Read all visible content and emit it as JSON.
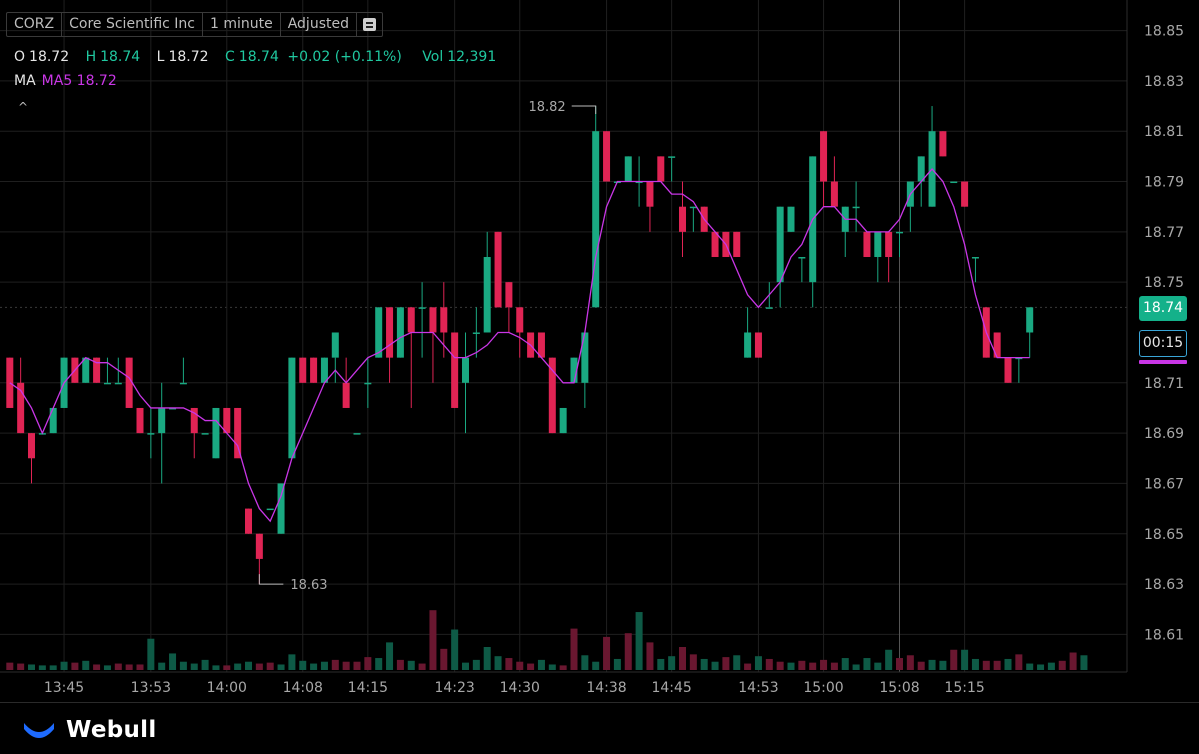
{
  "header": {
    "symbol": "CORZ",
    "name": "Core Scientific Inc",
    "interval": "1 minute",
    "adjust": "Adjusted"
  },
  "ohlc": {
    "o_label": "O",
    "o": "18.72",
    "h_label": "H",
    "h": "18.74",
    "l_label": "L",
    "l": "18.72",
    "c_label": "C",
    "c": "18.74",
    "change": "+0.02 (+0.11%)",
    "vol_label": "Vol",
    "vol": "12,391"
  },
  "ma": {
    "label": "MA",
    "text": "MA5 18.72"
  },
  "current_price": "18.74",
  "countdown": "00:15",
  "brand": "Webull",
  "colors": {
    "up": "#1aa982",
    "down": "#e02454",
    "ma": "#c936e6",
    "accent": "#14b18a"
  },
  "chart_data": {
    "type": "candlestick",
    "y_ticks": [
      "18.85",
      "18.83",
      "18.81",
      "18.79",
      "18.77",
      "18.75",
      "18.74",
      "18.71",
      "18.69",
      "18.67",
      "18.65",
      "18.63",
      "18.61"
    ],
    "x_ticks": [
      {
        "label": "13:45",
        "i": 5
      },
      {
        "label": "13:53",
        "i": 13
      },
      {
        "label": "14:00",
        "i": 20
      },
      {
        "label": "14:08",
        "i": 27
      },
      {
        "label": "14:15",
        "i": 33
      },
      {
        "label": "14:23",
        "i": 41
      },
      {
        "label": "14:30",
        "i": 47
      },
      {
        "label": "14:38",
        "i": 55
      },
      {
        "label": "14:45",
        "i": 61
      },
      {
        "label": "14:53",
        "i": 69
      },
      {
        "label": "15:00",
        "i": 75
      },
      {
        "label": "15:08",
        "i": 82
      },
      {
        "label": "15:15",
        "i": 88
      }
    ],
    "ylim": [
      18.603,
      18.855
    ],
    "high_annotation": "18.82",
    "low_annotation": "18.63",
    "grid": true,
    "candles": [
      [
        18.72,
        18.72,
        18.7,
        18.7
      ],
      [
        18.71,
        18.72,
        18.69,
        18.69
      ],
      [
        18.69,
        18.69,
        18.67,
        18.68
      ],
      [
        18.69,
        18.69,
        18.69,
        18.69
      ],
      [
        18.69,
        18.7,
        18.69,
        18.7
      ],
      [
        18.7,
        18.72,
        18.7,
        18.72
      ],
      [
        18.72,
        18.72,
        18.71,
        18.71
      ],
      [
        18.71,
        18.72,
        18.71,
        18.72
      ],
      [
        18.72,
        18.72,
        18.71,
        18.71
      ],
      [
        18.71,
        18.72,
        18.71,
        18.71
      ],
      [
        18.71,
        18.72,
        18.71,
        18.71
      ],
      [
        18.72,
        18.72,
        18.7,
        18.7
      ],
      [
        18.7,
        18.7,
        18.69,
        18.69
      ],
      [
        18.69,
        18.7,
        18.68,
        18.69
      ],
      [
        18.69,
        18.71,
        18.67,
        18.7
      ],
      [
        18.7,
        18.7,
        18.7,
        18.7
      ],
      [
        18.71,
        18.72,
        18.71,
        18.71
      ],
      [
        18.7,
        18.7,
        18.68,
        18.69
      ],
      [
        18.69,
        18.69,
        18.69,
        18.69
      ],
      [
        18.68,
        18.7,
        18.68,
        18.7
      ],
      [
        18.7,
        18.7,
        18.69,
        18.69
      ],
      [
        18.7,
        18.7,
        18.69,
        18.68
      ],
      [
        18.66,
        18.66,
        18.65,
        18.65
      ],
      [
        18.65,
        18.65,
        18.63,
        18.64
      ],
      [
        18.66,
        18.66,
        18.66,
        18.66
      ],
      [
        18.65,
        18.67,
        18.65,
        18.67
      ],
      [
        18.68,
        18.72,
        18.68,
        18.72
      ],
      [
        18.72,
        18.72,
        18.71,
        18.71
      ],
      [
        18.72,
        18.72,
        18.71,
        18.71
      ],
      [
        18.71,
        18.72,
        18.71,
        18.72
      ],
      [
        18.72,
        18.72,
        18.71,
        18.73
      ],
      [
        18.71,
        18.72,
        18.7,
        18.7
      ],
      [
        18.69,
        18.69,
        18.69,
        18.69
      ],
      [
        18.71,
        18.72,
        18.7,
        18.71
      ],
      [
        18.72,
        18.74,
        18.72,
        18.74
      ],
      [
        18.74,
        18.74,
        18.71,
        18.72
      ],
      [
        18.72,
        18.74,
        18.72,
        18.74
      ],
      [
        18.74,
        18.74,
        18.7,
        18.73
      ],
      [
        18.74,
        18.75,
        18.72,
        18.74
      ],
      [
        18.74,
        18.74,
        18.71,
        18.73
      ],
      [
        18.74,
        18.75,
        18.72,
        18.73
      ],
      [
        18.73,
        18.73,
        18.7,
        18.7
      ],
      [
        18.71,
        18.73,
        18.69,
        18.72
      ],
      [
        18.73,
        18.74,
        18.72,
        18.73
      ],
      [
        18.73,
        18.77,
        18.73,
        18.76
      ],
      [
        18.77,
        18.77,
        18.74,
        18.74
      ],
      [
        18.75,
        18.75,
        18.73,
        18.74
      ],
      [
        18.74,
        18.74,
        18.72,
        18.73
      ],
      [
        18.73,
        18.73,
        18.72,
        18.72
      ],
      [
        18.73,
        18.73,
        18.72,
        18.72
      ],
      [
        18.72,
        18.72,
        18.69,
        18.69
      ],
      [
        18.69,
        18.7,
        18.69,
        18.7
      ],
      [
        18.71,
        18.72,
        18.71,
        18.72
      ],
      [
        18.71,
        18.72,
        18.7,
        18.73
      ],
      [
        18.74,
        18.82,
        18.74,
        18.81
      ],
      [
        18.81,
        18.81,
        18.79,
        18.79
      ],
      [
        18.79,
        18.79,
        18.79,
        18.79
      ],
      [
        18.79,
        18.8,
        18.79,
        18.8
      ],
      [
        18.79,
        18.8,
        18.78,
        18.79
      ],
      [
        18.79,
        18.79,
        18.77,
        18.78
      ],
      [
        18.8,
        18.8,
        18.79,
        18.79
      ],
      [
        18.8,
        18.8,
        18.79,
        18.8
      ],
      [
        18.78,
        18.79,
        18.76,
        18.77
      ],
      [
        18.78,
        18.78,
        18.77,
        18.78
      ],
      [
        18.78,
        18.78,
        18.77,
        18.77
      ],
      [
        18.77,
        18.77,
        18.76,
        18.76
      ],
      [
        18.77,
        18.77,
        18.76,
        18.76
      ],
      [
        18.77,
        18.77,
        18.76,
        18.76
      ],
      [
        18.72,
        18.74,
        18.72,
        18.73
      ],
      [
        18.73,
        18.73,
        18.72,
        18.72
      ],
      [
        18.74,
        18.75,
        18.74,
        18.74
      ],
      [
        18.75,
        18.78,
        18.74,
        18.78
      ],
      [
        18.77,
        18.78,
        18.77,
        18.78
      ],
      [
        18.76,
        18.76,
        18.75,
        18.76
      ],
      [
        18.75,
        18.8,
        18.74,
        18.8
      ],
      [
        18.81,
        18.81,
        18.78,
        18.79
      ],
      [
        18.79,
        18.8,
        18.78,
        18.78
      ],
      [
        18.77,
        18.78,
        18.76,
        18.78
      ],
      [
        18.78,
        18.79,
        18.77,
        18.78
      ],
      [
        18.77,
        18.77,
        18.76,
        18.76
      ],
      [
        18.76,
        18.77,
        18.75,
        18.77
      ],
      [
        18.77,
        18.77,
        18.75,
        18.76
      ],
      [
        18.77,
        18.77,
        18.76,
        18.77
      ],
      [
        18.78,
        18.78,
        18.77,
        18.79
      ],
      [
        18.79,
        18.8,
        18.78,
        18.8
      ],
      [
        18.78,
        18.82,
        18.78,
        18.81
      ],
      [
        18.81,
        18.81,
        18.8,
        18.8
      ],
      [
        18.79,
        18.79,
        18.79,
        18.79
      ],
      [
        18.79,
        18.79,
        18.78,
        18.78
      ],
      [
        18.76,
        18.76,
        18.75,
        18.76
      ],
      [
        18.74,
        18.74,
        18.72,
        18.72
      ],
      [
        18.73,
        18.73,
        18.72,
        18.72
      ],
      [
        18.72,
        18.72,
        18.71,
        18.71
      ],
      [
        18.72,
        18.72,
        18.71,
        18.72
      ],
      [
        18.73,
        18.74,
        18.72,
        18.74
      ]
    ],
    "ma5": [
      18.71,
      18.707,
      18.7,
      18.69,
      18.7,
      18.71,
      18.715,
      18.72,
      18.718,
      18.718,
      18.715,
      18.712,
      18.705,
      18.7,
      18.7,
      18.7,
      18.7,
      18.698,
      18.695,
      18.695,
      18.69,
      18.685,
      18.67,
      18.66,
      18.655,
      18.665,
      18.68,
      18.69,
      18.7,
      18.71,
      18.715,
      18.71,
      18.715,
      18.72,
      18.722,
      18.725,
      18.728,
      18.73,
      18.73,
      18.73,
      18.725,
      18.72,
      18.72,
      18.722,
      18.725,
      18.73,
      18.73,
      18.728,
      18.725,
      18.72,
      18.715,
      18.71,
      18.71,
      18.73,
      18.76,
      18.78,
      18.79,
      18.79,
      18.79,
      18.79,
      18.79,
      18.785,
      18.785,
      18.782,
      18.775,
      18.77,
      18.765,
      18.755,
      18.745,
      18.74,
      18.745,
      18.75,
      18.76,
      18.765,
      18.775,
      18.78,
      18.78,
      18.775,
      18.775,
      18.77,
      18.77,
      18.77,
      18.775,
      18.785,
      18.79,
      18.795,
      18.79,
      18.78,
      18.765,
      18.745,
      18.73,
      18.72,
      18.72,
      18.72,
      18.72
    ],
    "volume": [
      [
        8,
        "d"
      ],
      [
        7,
        "d"
      ],
      [
        6,
        "u"
      ],
      [
        5,
        "u"
      ],
      [
        5,
        "u"
      ],
      [
        9,
        "u"
      ],
      [
        8,
        "d"
      ],
      [
        10,
        "u"
      ],
      [
        6,
        "d"
      ],
      [
        5,
        "u"
      ],
      [
        7,
        "d"
      ],
      [
        6,
        "d"
      ],
      [
        6,
        "d"
      ],
      [
        34,
        "u"
      ],
      [
        8,
        "u"
      ],
      [
        18,
        "u"
      ],
      [
        9,
        "u"
      ],
      [
        7,
        "u"
      ],
      [
        11,
        "u"
      ],
      [
        5,
        "u"
      ],
      [
        5,
        "d"
      ],
      [
        7,
        "u"
      ],
      [
        9,
        "u"
      ],
      [
        7,
        "d"
      ],
      [
        8,
        "d"
      ],
      [
        6,
        "u"
      ],
      [
        17,
        "u"
      ],
      [
        10,
        "u"
      ],
      [
        7,
        "u"
      ],
      [
        9,
        "u"
      ],
      [
        11,
        "d"
      ],
      [
        9,
        "d"
      ],
      [
        9,
        "d"
      ],
      [
        14,
        "d"
      ],
      [
        13,
        "u"
      ],
      [
        30,
        "u"
      ],
      [
        11,
        "d"
      ],
      [
        10,
        "u"
      ],
      [
        7,
        "d"
      ],
      [
        65,
        "d"
      ],
      [
        23,
        "d"
      ],
      [
        44,
        "u"
      ],
      [
        8,
        "u"
      ],
      [
        11,
        "u"
      ],
      [
        25,
        "u"
      ],
      [
        15,
        "u"
      ],
      [
        13,
        "d"
      ],
      [
        9,
        "d"
      ],
      [
        7,
        "d"
      ],
      [
        11,
        "u"
      ],
      [
        6,
        "u"
      ],
      [
        5,
        "d"
      ],
      [
        45,
        "d"
      ],
      [
        16,
        "u"
      ],
      [
        9,
        "u"
      ],
      [
        36,
        "d"
      ],
      [
        12,
        "u"
      ],
      [
        40,
        "d"
      ],
      [
        63,
        "u"
      ],
      [
        30,
        "d"
      ],
      [
        12,
        "u"
      ],
      [
        15,
        "u"
      ],
      [
        25,
        "d"
      ],
      [
        17,
        "d"
      ],
      [
        12,
        "u"
      ],
      [
        9,
        "u"
      ],
      [
        14,
        "d"
      ],
      [
        16,
        "u"
      ],
      [
        7,
        "d"
      ],
      [
        15,
        "u"
      ],
      [
        12,
        "d"
      ],
      [
        9,
        "d"
      ],
      [
        8,
        "u"
      ],
      [
        10,
        "d"
      ],
      [
        8,
        "d"
      ],
      [
        11,
        "d"
      ],
      [
        8,
        "d"
      ],
      [
        13,
        "u"
      ],
      [
        6,
        "u"
      ],
      [
        13,
        "u"
      ],
      [
        8,
        "u"
      ],
      [
        22,
        "u"
      ],
      [
        13,
        "d"
      ],
      [
        16,
        "d"
      ],
      [
        9,
        "d"
      ],
      [
        11,
        "u"
      ],
      [
        10,
        "u"
      ],
      [
        22,
        "d"
      ],
      [
        22,
        "u"
      ],
      [
        12,
        "u"
      ],
      [
        10,
        "d"
      ],
      [
        10,
        "d"
      ],
      [
        12,
        "u"
      ],
      [
        17,
        "d"
      ],
      [
        7,
        "u"
      ],
      [
        6,
        "u"
      ],
      [
        8,
        "u"
      ],
      [
        10,
        "d"
      ],
      [
        19,
        "d"
      ],
      [
        16,
        "u"
      ]
    ]
  }
}
